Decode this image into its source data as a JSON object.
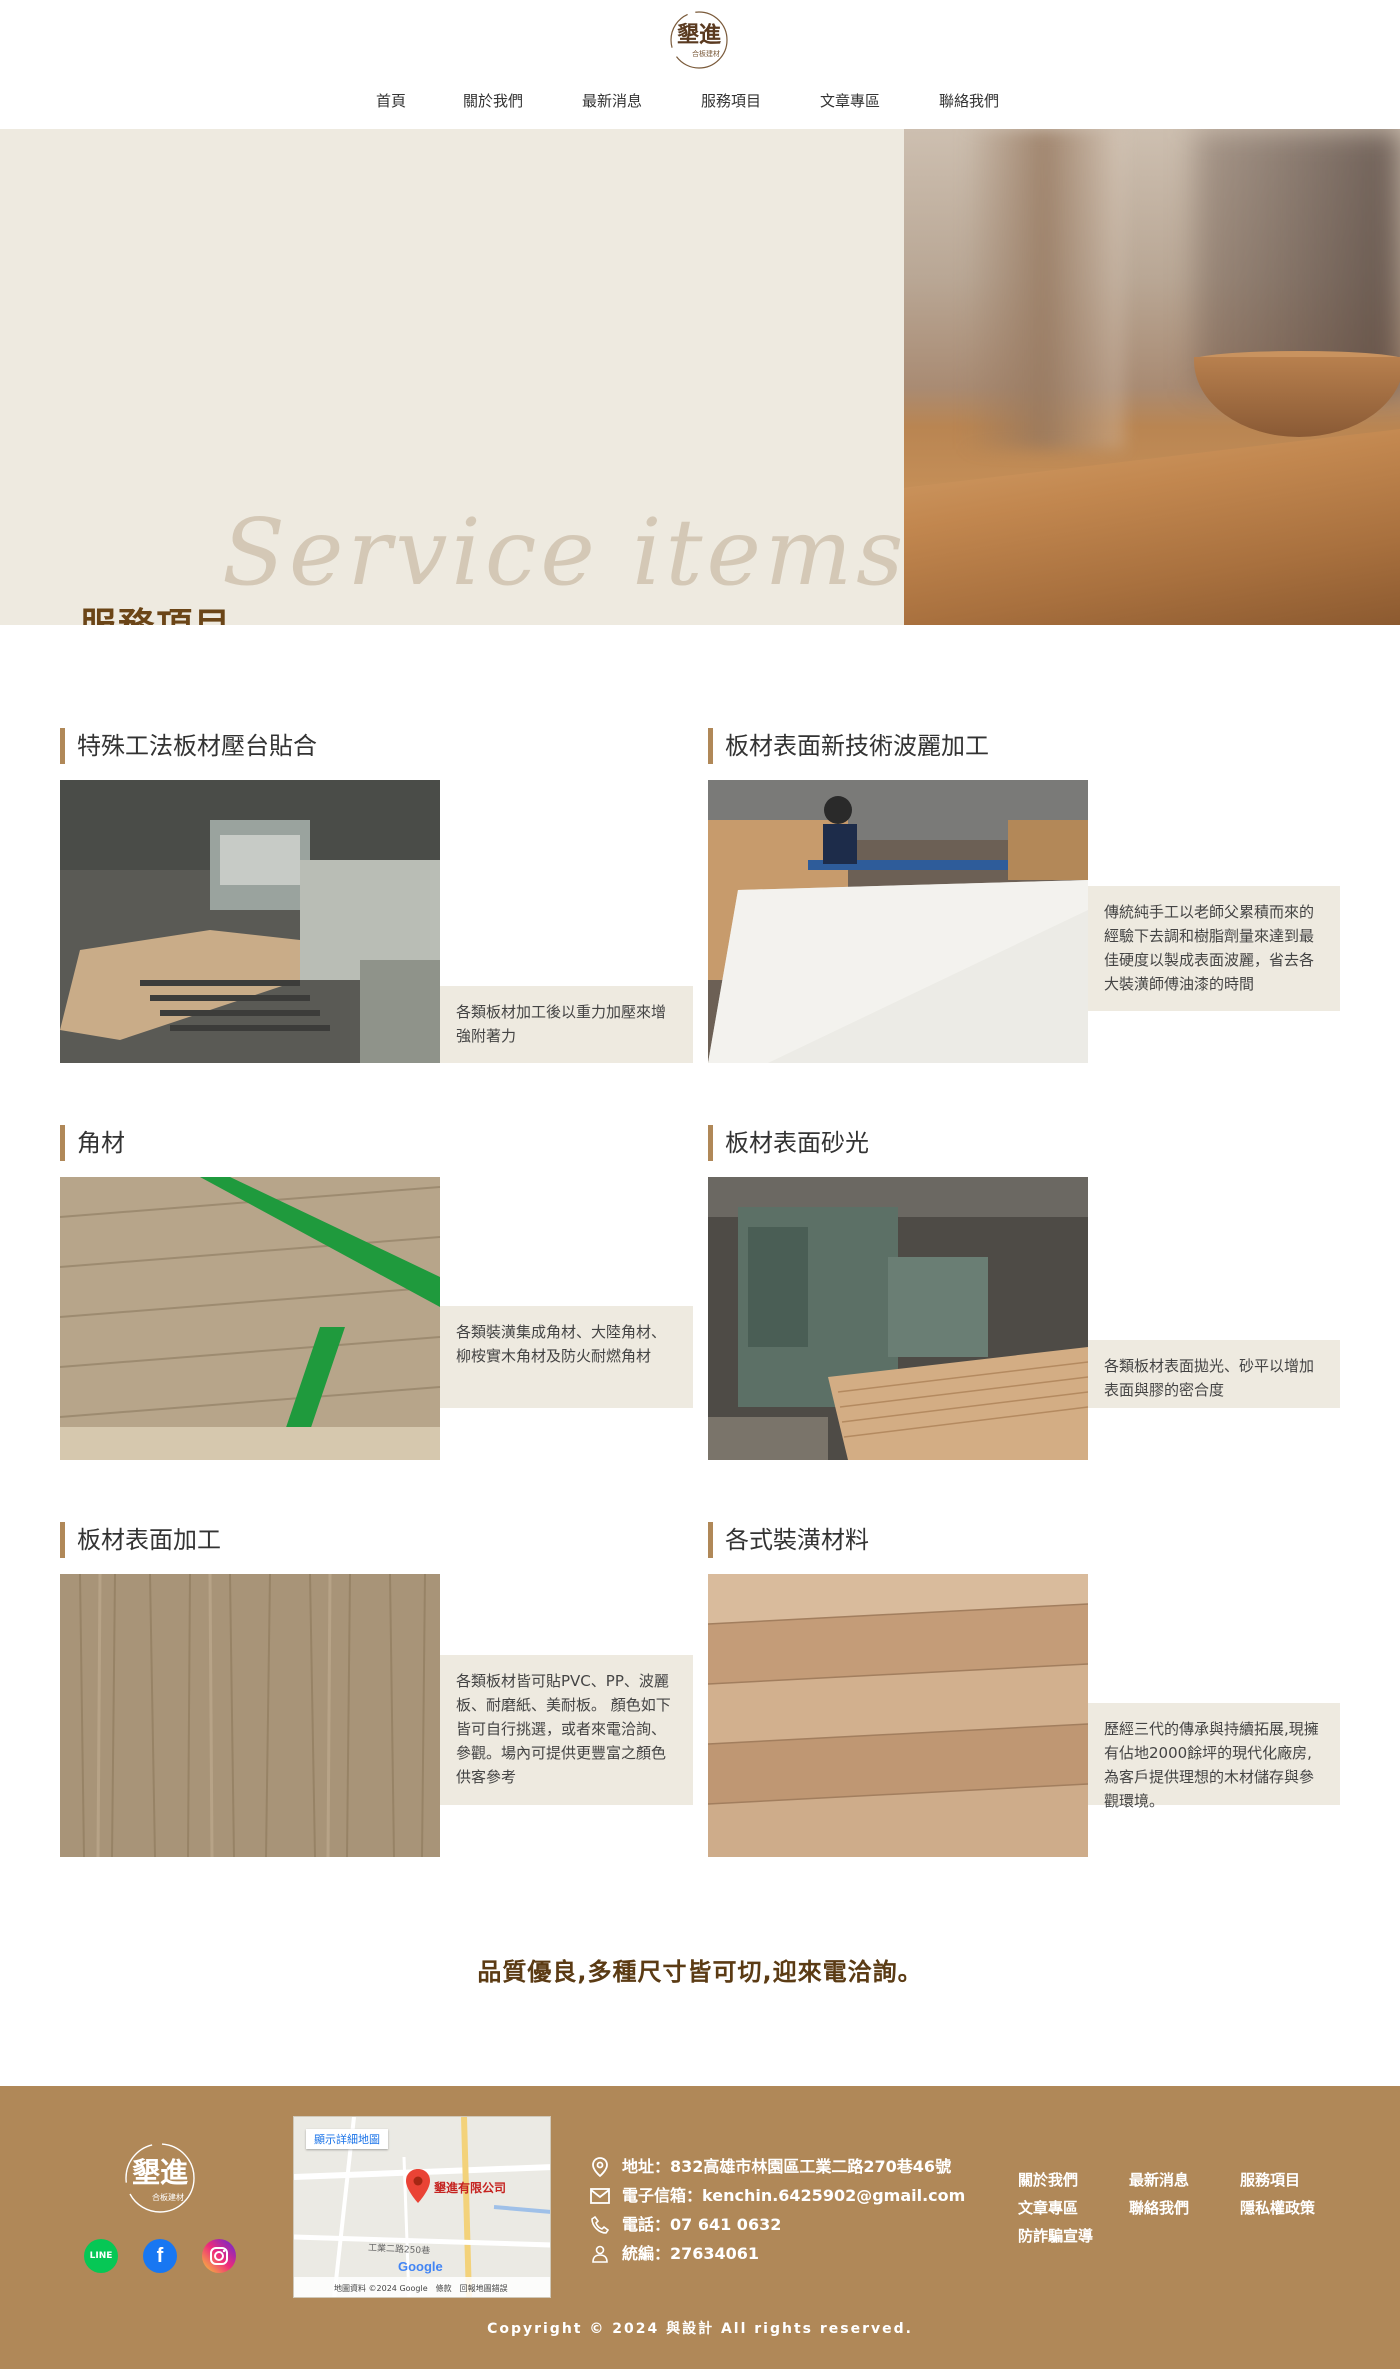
{
  "header": {
    "logo_text": "墾進",
    "logo_sub": "合板建材",
    "nav": [
      "首頁",
      "關於我們",
      "最新消息",
      "服務項目",
      "文章專區",
      "聯絡我們"
    ]
  },
  "hero": {
    "script_text": "Service items",
    "title": "服務項目"
  },
  "services": [
    {
      "title": "特殊工法板材壓台貼合",
      "desc": "各類板材加工後以重力加壓來增強附著力"
    },
    {
      "title": "板材表面新技術波麗加工",
      "desc": "傳統純手工以老師父累積而來的經驗下去調和樹脂劑量來達到最佳硬度以製成表面波麗，省去各大裝潢師傅油漆的時間"
    },
    {
      "title": "角材",
      "desc": "各類裝潢集成角材、大陸角材、柳桉實木角材及防火耐燃角材"
    },
    {
      "title": "板材表面砂光",
      "desc": "各類板材表面拋光、砂平以增加表面與膠的密合度"
    },
    {
      "title": "板材表面加工",
      "desc": "各類板材皆可貼PVC、PP、波麗板、耐磨紙、美耐板。 顏色如下皆可自行挑選，或者來電洽詢、參觀。場內可提供更豐富之顏色供客參考"
    },
    {
      "title": "各式裝潢材料",
      "desc": "歷經三代的傳承與持續拓展,現擁有佔地2000餘坪的現代化廠房,為客戶提供理想的木材儲存與參觀環境。"
    }
  ],
  "slogan": "品質優良,多種尺寸皆可切,迎來電洽詢。",
  "footer": {
    "social": [
      "LINE",
      "f",
      "ig"
    ],
    "map": {
      "button": "顯示詳細地圖",
      "marker_label": "墾進有限公司",
      "road": "工業二路250巷",
      "brand": "Google",
      "credits": "地圖資料 ©2024 Google　條款　回報地圖錯誤"
    },
    "contact": {
      "address": "地址：832高雄市林園區工業二路270巷46號",
      "email": "電子信箱：kenchin.6425902@gmail.com",
      "phone": "電話：07 641 0632",
      "tax_id": "統編：27634061"
    },
    "links": [
      "關於我們",
      "最新消息",
      "服務項目",
      "文章專區",
      "聯絡我們",
      "隱私權政策",
      "防詐騙宣導"
    ],
    "copyright": "Copyright © 2024 與設計 All rights reserved."
  },
  "colors": {
    "accent": "#b08858",
    "hero_bg": "#eeeae0",
    "title_brown": "#6b4517"
  }
}
